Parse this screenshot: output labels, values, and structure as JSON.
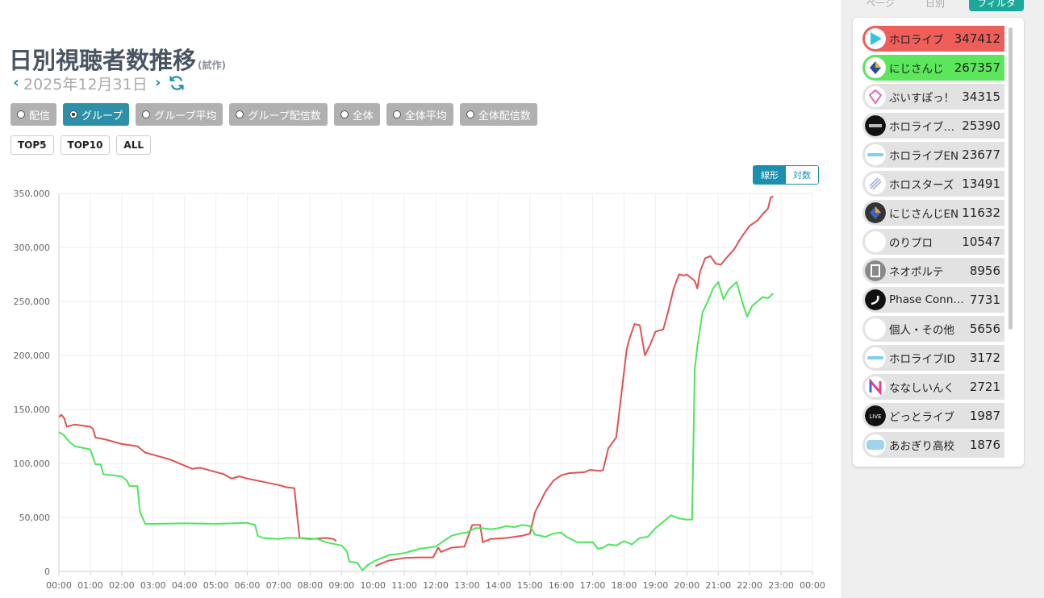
{
  "page": {
    "title": "日別視聴者数推移",
    "title_note": "(試作)",
    "date": "2025年12月31日"
  },
  "modes": [
    {
      "label": "配信",
      "active": false
    },
    {
      "label": "グループ",
      "active": true
    },
    {
      "label": "グループ平均",
      "active": false
    },
    {
      "label": "グループ配信数",
      "active": false
    },
    {
      "label": "全体",
      "active": false
    },
    {
      "label": "全体平均",
      "active": false
    },
    {
      "label": "全体配信数",
      "active": false
    }
  ],
  "tops": [
    "TOP5",
    "TOP10",
    "ALL"
  ],
  "scale": {
    "linear": "線形",
    "log": "対数",
    "selected": "linear"
  },
  "sidebar": {
    "tabs": [
      "ページ",
      "日別",
      "フィルタ"
    ],
    "active_tab": "フィルタ",
    "items": [
      {
        "name": "ホロライブ",
        "value": "347412",
        "highlight": "#ee5e5a",
        "icon": "hololive-play-icon"
      },
      {
        "name": "にじさんじ",
        "value": "267357",
        "highlight": "#5ce65c",
        "icon": "nijisanji-icon"
      },
      {
        "name": "ぶいすぽっ！",
        "value": "34315",
        "icon": "vspo-icon"
      },
      {
        "name": "ホロライブ…",
        "value": "25390",
        "icon": "holodev-icon"
      },
      {
        "name": "ホロライブEN",
        "value": "23677",
        "icon": "hololive-en-icon"
      },
      {
        "name": "ホロスターズ",
        "value": "13491",
        "icon": "holostars-icon"
      },
      {
        "name": "にじさんじEN",
        "value": "11632",
        "icon": "nijisanji-en-icon"
      },
      {
        "name": "のりプロ",
        "value": "10547",
        "icon": "noripro-icon"
      },
      {
        "name": "ネオポルテ",
        "value": "8956",
        "icon": "neoporte-icon"
      },
      {
        "name": "Phase Connect",
        "value": "7731",
        "icon": "phase-connect-icon"
      },
      {
        "name": "個人・その他",
        "value": "5656",
        "icon": "indie-icon"
      },
      {
        "name": "ホロライブID",
        "value": "3172",
        "icon": "hololive-id-icon"
      },
      {
        "name": "ななしいんく",
        "value": "2721",
        "icon": "nanashi-inc-icon"
      },
      {
        "name": "どっとライブ",
        "value": "1987",
        "icon": "dotlive-icon"
      },
      {
        "name": "あおぎり高校",
        "value": "1876",
        "icon": "aogiri-icon"
      }
    ]
  },
  "chart_data": {
    "type": "line",
    "x_unit": "time of day",
    "xlim": [
      "00:00",
      "24:00"
    ],
    "ylim": [
      0,
      350000
    ],
    "y_ticks": [
      "0",
      "50,000",
      "100,000",
      "150,000",
      "200,000",
      "250,000",
      "300,000",
      "350,000"
    ],
    "x_ticks": [
      "00:00",
      "01:00",
      "02:00",
      "03:00",
      "04:00",
      "05:00",
      "06:00",
      "07:00",
      "08:00",
      "09:00",
      "10:00",
      "11:00",
      "12:00",
      "13:00",
      "14:00",
      "15:00",
      "16:00",
      "17:00",
      "18:00",
      "19:00",
      "20:00",
      "21:00",
      "22:00",
      "23:00",
      "00:00"
    ],
    "grid": true,
    "legend": "none",
    "series": [
      {
        "color": "#e05252",
        "segments": [
          [
            [
              "00:00",
              143000
            ],
            [
              "00:05",
              145000
            ],
            [
              "00:10",
              142000
            ],
            [
              "00:15",
              134000
            ],
            [
              "00:30",
              136000
            ],
            [
              "00:45",
              135000
            ],
            [
              "01:00",
              134000
            ],
            [
              "01:05",
              132000
            ],
            [
              "01:10",
              124000
            ],
            [
              "01:30",
              122000
            ],
            [
              "02:00",
              118000
            ],
            [
              "02:30",
              116000
            ],
            [
              "02:45",
              110000
            ],
            [
              "03:00",
              108000
            ],
            [
              "03:30",
              104000
            ],
            [
              "04:00",
              98000
            ],
            [
              "04:15",
              95000
            ],
            [
              "04:30",
              96000
            ],
            [
              "05:00",
              92000
            ],
            [
              "05:15",
              90000
            ],
            [
              "05:30",
              86000
            ],
            [
              "05:45",
              88000
            ],
            [
              "06:00",
              86000
            ],
            [
              "06:30",
              83000
            ],
            [
              "07:00",
              80000
            ],
            [
              "07:15",
              78000
            ],
            [
              "07:30",
              77000
            ],
            [
              "07:35",
              53000
            ],
            [
              "07:40",
              31000
            ],
            [
              "08:00",
              30000
            ],
            [
              "08:30",
              31000
            ],
            [
              "08:45",
              30000
            ],
            [
              "08:50",
              28000
            ]
          ],
          [
            [
              "10:05",
              5000
            ],
            [
              "10:30",
              10000
            ],
            [
              "11:00",
              12500
            ],
            [
              "11:30",
              13000
            ],
            [
              "11:55",
              13000
            ],
            [
              "12:05",
              22000
            ],
            [
              "12:10",
              18000
            ],
            [
              "12:30",
              22000
            ],
            [
              "12:55",
              23000
            ],
            [
              "13:10",
              43000
            ],
            [
              "13:25",
              43000
            ],
            [
              "13:30",
              27000
            ],
            [
              "13:45",
              30000
            ],
            [
              "14:15",
              31000
            ],
            [
              "14:45",
              33000
            ],
            [
              "15:00",
              35000
            ],
            [
              "15:10",
              55000
            ],
            [
              "15:30",
              74000
            ],
            [
              "15:45",
              84000
            ],
            [
              "16:00",
              89000
            ],
            [
              "16:15",
              91000
            ],
            [
              "16:45",
              92000
            ],
            [
              "16:55",
              94000
            ],
            [
              "17:15",
              93000
            ],
            [
              "17:20",
              94000
            ],
            [
              "17:30",
              114000
            ],
            [
              "17:45",
              124000
            ],
            [
              "17:55",
              165000
            ],
            [
              "18:05",
              205000
            ],
            [
              "18:10",
              215000
            ],
            [
              "18:20",
              229000
            ],
            [
              "18:30",
              228000
            ],
            [
              "18:40",
              200000
            ],
            [
              "18:50",
              210000
            ],
            [
              "19:00",
              222000
            ],
            [
              "19:15",
              224000
            ],
            [
              "19:25",
              242000
            ],
            [
              "19:35",
              262000
            ],
            [
              "19:45",
              275000
            ],
            [
              "19:55",
              274000
            ],
            [
              "20:00",
              275000
            ],
            [
              "20:15",
              269000
            ],
            [
              "20:20",
              262000
            ],
            [
              "20:25",
              277000
            ],
            [
              "20:35",
              290000
            ],
            [
              "20:45",
              292000
            ],
            [
              "20:55",
              285000
            ],
            [
              "21:05",
              284000
            ],
            [
              "21:15",
              290000
            ],
            [
              "21:30",
              298000
            ],
            [
              "21:45",
              310000
            ],
            [
              "22:00",
              320000
            ],
            [
              "22:15",
              325000
            ],
            [
              "22:25",
              331000
            ],
            [
              "22:35",
              336000
            ],
            [
              "22:40",
              346000
            ],
            [
              "22:45",
              347412
            ]
          ]
        ]
      },
      {
        "color": "#4ce65c",
        "segments": [
          [
            [
              "00:00",
              129000
            ],
            [
              "00:10",
              126000
            ],
            [
              "00:20",
              120000
            ],
            [
              "00:30",
              116000
            ],
            [
              "01:00",
              113000
            ],
            [
              "01:10",
              99000
            ],
            [
              "01:20",
              99000
            ],
            [
              "01:25",
              90000
            ],
            [
              "02:00",
              88000
            ],
            [
              "02:10",
              84000
            ],
            [
              "02:15",
              79000
            ],
            [
              "02:30",
              79000
            ],
            [
              "02:35",
              55000
            ],
            [
              "02:45",
              44000
            ],
            [
              "03:00",
              44000
            ],
            [
              "04:00",
              44500
            ],
            [
              "05:00",
              44000
            ],
            [
              "06:00",
              45000
            ],
            [
              "06:15",
              43000
            ],
            [
              "06:20",
              33000
            ],
            [
              "06:30",
              31000
            ],
            [
              "07:00",
              30000
            ],
            [
              "07:15",
              31000
            ],
            [
              "07:45",
              31000
            ],
            [
              "08:15",
              30000
            ],
            [
              "08:30",
              27000
            ],
            [
              "09:00",
              24000
            ],
            [
              "09:10",
              19000
            ],
            [
              "09:15",
              9000
            ],
            [
              "09:30",
              8000
            ],
            [
              "09:40",
              1000
            ],
            [
              "09:50",
              6000
            ],
            [
              "10:05",
              10000
            ],
            [
              "10:30",
              15000
            ],
            [
              "11:00",
              17000
            ],
            [
              "11:30",
              21000
            ],
            [
              "12:00",
              23000
            ],
            [
              "12:15",
              28000
            ],
            [
              "12:30",
              33000
            ],
            [
              "12:45",
              35000
            ],
            [
              "13:00",
              36000
            ],
            [
              "13:15",
              40000
            ],
            [
              "13:30",
              40000
            ],
            [
              "13:45",
              39000
            ],
            [
              "14:00",
              40000
            ],
            [
              "14:15",
              42000
            ],
            [
              "14:30",
              41000
            ],
            [
              "14:45",
              43000
            ],
            [
              "15:00",
              42000
            ],
            [
              "15:10",
              34000
            ],
            [
              "15:30",
              32000
            ],
            [
              "15:45",
              35000
            ],
            [
              "16:00",
              36000
            ],
            [
              "16:10",
              32000
            ],
            [
              "16:30",
              27000
            ],
            [
              "17:00",
              27000
            ],
            [
              "17:10",
              21000
            ],
            [
              "17:20",
              22000
            ],
            [
              "17:30",
              25000
            ],
            [
              "17:45",
              24000
            ],
            [
              "18:00",
              28000
            ],
            [
              "18:15",
              25000
            ],
            [
              "18:30",
              31000
            ],
            [
              "18:45",
              32000
            ],
            [
              "19:00",
              40000
            ],
            [
              "19:15",
              46000
            ],
            [
              "19:30",
              52000
            ],
            [
              "19:45",
              49000
            ],
            [
              "20:00",
              48000
            ],
            [
              "20:10",
              48000
            ],
            [
              "20:15",
              187000
            ],
            [
              "20:20",
              208000
            ],
            [
              "20:30",
              240000
            ],
            [
              "20:40",
              250000
            ],
            [
              "20:50",
              262000
            ],
            [
              "21:00",
              268000
            ],
            [
              "21:10",
              252000
            ],
            [
              "21:20",
              261000
            ],
            [
              "21:35",
              268000
            ],
            [
              "21:45",
              251000
            ],
            [
              "21:55",
              236000
            ],
            [
              "22:05",
              246000
            ],
            [
              "22:15",
              250000
            ],
            [
              "22:25",
              254000
            ],
            [
              "22:35",
              253000
            ],
            [
              "22:45",
              257357
            ]
          ]
        ]
      }
    ]
  }
}
